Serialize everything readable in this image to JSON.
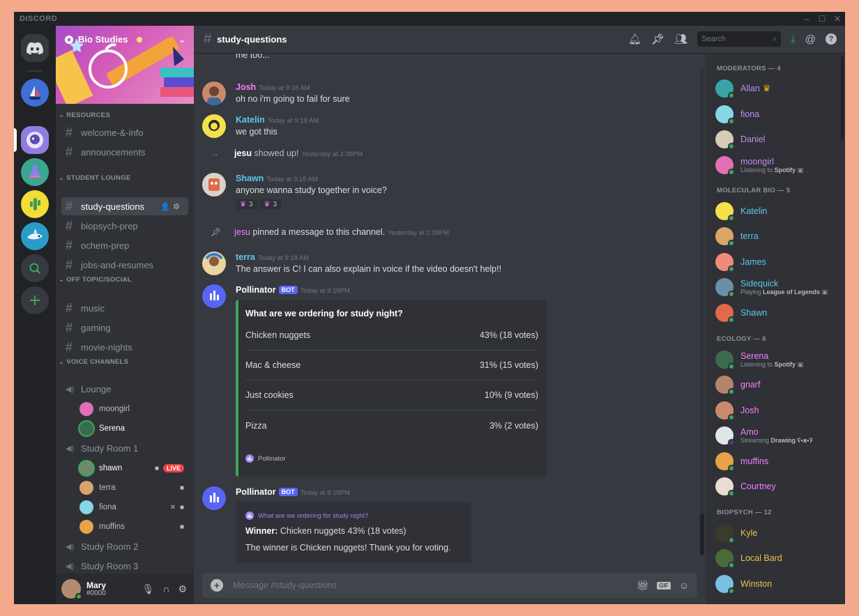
{
  "app": {
    "brand": "DISCORD",
    "window_controls": [
      "–",
      "☐",
      "✕"
    ]
  },
  "colors": {
    "accent": "#5865f2",
    "online": "#3ba55c",
    "live": "#ed4245",
    "embed_border": "#3ba55c"
  },
  "server": {
    "name": "Bio Studies"
  },
  "categories": {
    "resources": "RESOURCES",
    "lounge": "STUDENT LOUNGE",
    "social": "OFF TOPIC/SOCIAL",
    "voice": "VOICE CHANNELS"
  },
  "channels": {
    "welcome": "welcome-&-info",
    "announcements": "announcements",
    "study": "study-questions",
    "biopsych": "biopsych-prep",
    "ochem": "ochem-prep",
    "jobs": "jobs-and-resumes",
    "music": "music",
    "gaming": "gaming",
    "movies": "movie-nights"
  },
  "voice": {
    "lounge": "Lounge",
    "room1": "Study Room 1",
    "room2": "Study Room 2",
    "room3": "Study Room 3",
    "lounge_users": [
      "moongirl",
      "Serena"
    ],
    "room1_users": [
      "shawn",
      "terra",
      "fiona",
      "muffins"
    ],
    "live_label": "LIVE"
  },
  "user": {
    "name": "Mary",
    "tag": "#0000"
  },
  "header": {
    "channel": "study-questions",
    "search_placeholder": "Search"
  },
  "messages": {
    "prev_tail": "me too...",
    "josh": {
      "author": "Josh",
      "time": "Today at 9:18 AM",
      "text": "oh no i'm going to fail for sure"
    },
    "katelin": {
      "author": "Katelin",
      "time": "Today at 9:18 AM",
      "text": "we got this"
    },
    "join": {
      "user": "jesu",
      "text": "showed up!",
      "time": "Yesterday at 2:38PM"
    },
    "shawn": {
      "author": "Shawn",
      "time": "Today at 9:18 AM",
      "text": "anyone wanna study together in voice?",
      "reactions": [
        "3",
        "3"
      ]
    },
    "pin": {
      "user": "jesu",
      "text": "pinned a message to this channel.",
      "time": "Yesterday at 2:38PM"
    },
    "terra": {
      "author": "terra",
      "time": "Today at 9:18 AM",
      "text": "The answer is C! I can also explain in voice if the video doesn't help!!"
    },
    "bot1": {
      "author": "Pollinator",
      "badge": "BOT",
      "time": "Today at 6:18PM"
    },
    "bot2": {
      "author": "Pollinator",
      "badge": "BOT",
      "time": "Today at 6:18PM"
    }
  },
  "poll": {
    "question": "What are we ordering for study night?",
    "options": [
      {
        "label": "Chicken nuggets",
        "result": "43% (18 votes)"
      },
      {
        "label": "Mac & cheese",
        "result": "31% (15 votes)"
      },
      {
        "label": "Just cookies",
        "result": "10% (9 votes)"
      },
      {
        "label": "Pizza",
        "result": "3% (2 votes)"
      }
    ],
    "footer": "Pollinator"
  },
  "result": {
    "question": "What are we ordering for study night?",
    "winner_label": "Winner:",
    "winner_value": "Chicken nuggets 43% (18 votes)",
    "text": "The winner is Chicken nuggets! Thank you for voting."
  },
  "composer": {
    "placeholder": "Message #study-questions"
  },
  "members": {
    "moderators": {
      "title": "MODERATORS — 4",
      "list": [
        {
          "name": "Allan",
          "sub": ""
        },
        {
          "name": "fiona",
          "sub": ""
        },
        {
          "name": "Daniel",
          "sub": ""
        },
        {
          "name": "moongirl",
          "sub": "Listening to",
          "sub_bold": "Spotify"
        }
      ]
    },
    "molecular": {
      "title": "MOLECULAR BIO — 5",
      "list": [
        {
          "name": "Katelin",
          "sub": ""
        },
        {
          "name": "terra",
          "sub": ""
        },
        {
          "name": "James",
          "sub": ""
        },
        {
          "name": "Sidequick",
          "sub": "Playing",
          "sub_bold": "League of Legends"
        },
        {
          "name": "Shawn",
          "sub": ""
        }
      ]
    },
    "ecology": {
      "title": "ECOLOGY — 6",
      "list": [
        {
          "name": "Serena",
          "sub": "Listening to",
          "sub_bold": "Spotify"
        },
        {
          "name": "gnarf",
          "sub": ""
        },
        {
          "name": "Josh",
          "sub": ""
        },
        {
          "name": "Amo",
          "sub": "Streaming",
          "sub_bold": "Drawing ʕ•ᴥ•ʔ"
        },
        {
          "name": "muffins",
          "sub": ""
        },
        {
          "name": "Courtney",
          "sub": ""
        }
      ]
    },
    "biopsych": {
      "title": "BIOPSYCH — 12",
      "list": [
        {
          "name": "Kyle",
          "sub": ""
        },
        {
          "name": "Local Bard",
          "sub": ""
        },
        {
          "name": "Winston",
          "sub": ""
        }
      ]
    }
  }
}
